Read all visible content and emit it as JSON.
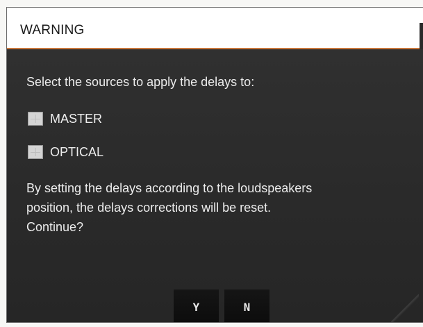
{
  "dialog": {
    "title": "WARNING",
    "prompt": "Select the sources to apply the delays to:",
    "options": [
      {
        "label": "MASTER",
        "checked": false
      },
      {
        "label": "OPTICAL",
        "checked": false
      }
    ],
    "message_lines": [
      "By setting the delays according to the loudspeakers",
      "position, the delays corrections will be reset.",
      "Continue?"
    ],
    "buttons": {
      "yes_label": "Y",
      "no_label": "N"
    }
  },
  "colors": {
    "title_bar": "#ffffff",
    "title_border_accent": "#c9773c",
    "body_background": "#2b2b2b",
    "button_background": "#111111",
    "text": "#ececec"
  }
}
